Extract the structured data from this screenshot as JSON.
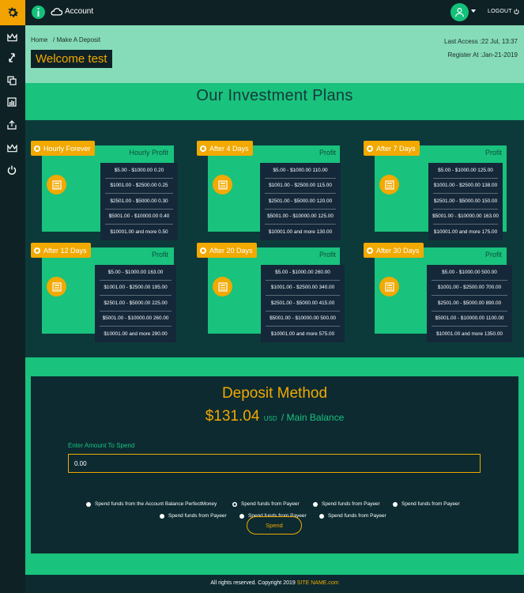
{
  "topbar": {
    "account_label": "Account",
    "logout_label": "LOGOUT"
  },
  "sidebar": {
    "icons": [
      "crown-icon",
      "exchange-icon",
      "copy-icon",
      "chart-icon",
      "upload-icon",
      "crown-icon",
      "power-icon"
    ]
  },
  "header": {
    "breadcrumb_home": "Home",
    "breadcrumb_current": "/ Make A Deposit",
    "welcome": "Welcome test",
    "last_access": "Last Access :22 Jul, 13:37",
    "register": "Register At :Jan-21-2019"
  },
  "plans_title": "Our Investment Plans",
  "plans": [
    {
      "tag": "Hourly Forever",
      "head": "Hourly Profit",
      "rates": [
        "$5.00 - $1000.00 0.20",
        "$1001.00 - $2500.00 0.25",
        "$2501.00 - $5000.00 0.30",
        "$5001.00 - $10000.00 0.40",
        "$10001.00 and more 0.50"
      ]
    },
    {
      "tag": "After 4 Days",
      "head": "Profit",
      "rates": [
        "$5.00 - $1000.00 110.00",
        "$1001.00 - $2500.00 115.00",
        "$2501.00 - $5000.00 120.00",
        "$5001.00 - $10000.00 125.00",
        "$10001.00 and more 130.00"
      ]
    },
    {
      "tag": "After 7 Days",
      "head": "Profit",
      "rates": [
        "$5.00 - $1000.00 125.00",
        "$1001.00 - $2500.00 138.00",
        "$2501.00 - $5000.00 150.00",
        "$5001.00 - $10000.00 163.00",
        "$10001.00 and more 175.00"
      ]
    },
    {
      "tag": "After 12 Days",
      "head": "Profit",
      "rates": [
        "$5.00 - $1000.00 163.00",
        "$1001.00 - $2500.00 195.00",
        "$2501.00 - $5000.00 225.00",
        "$5001.00 - $10000.00 260.00",
        "$10001.00 and more 290.00"
      ]
    },
    {
      "tag": "After 20 Days",
      "head": "Profit",
      "rates": [
        "$5.00 - $1000.00 260.00",
        "$1001.00 - $2500.00 340.00",
        "$2501.00 - $5000.00 415.00",
        "$5001.00 - $10000.00 500.00",
        "$10001.00 and more 575.00"
      ]
    },
    {
      "tag": "After 30 Days",
      "head": "Profit",
      "rates": [
        "$5.00 - $1000.00 500.00",
        "$1001.00 - $2500.00 700.00",
        "$2501.00 - $5000.00 890.00",
        "$5001.00 - $10000.00 1100.00",
        "$10001.00 and more 1350.00"
      ]
    }
  ],
  "deposit": {
    "title": "Deposit Method",
    "balance_amount": "$131.04",
    "balance_currency": "USD",
    "balance_label": "/ Main Balance",
    "amount_label": "Enter Amount To Spend",
    "amount_value": "0.00",
    "options": [
      "Spend funds from the Account Balance PerfectMoney",
      "Spend funds from Payeer",
      "Spend funds from Payeer",
      "Spend funds from Payeer",
      "Spend funds from Payeer",
      "Spend funds from Payeer",
      "Spend funds from Payeer"
    ],
    "selected_option_index": 1,
    "spend_label": "Spend"
  },
  "footer": {
    "text": "All rights reserved. Copyright 2019",
    "site": "SITE NAME.com"
  },
  "colors": {
    "accent": "#f2a900",
    "green": "#19c27d",
    "dark": "#0c2a30"
  }
}
